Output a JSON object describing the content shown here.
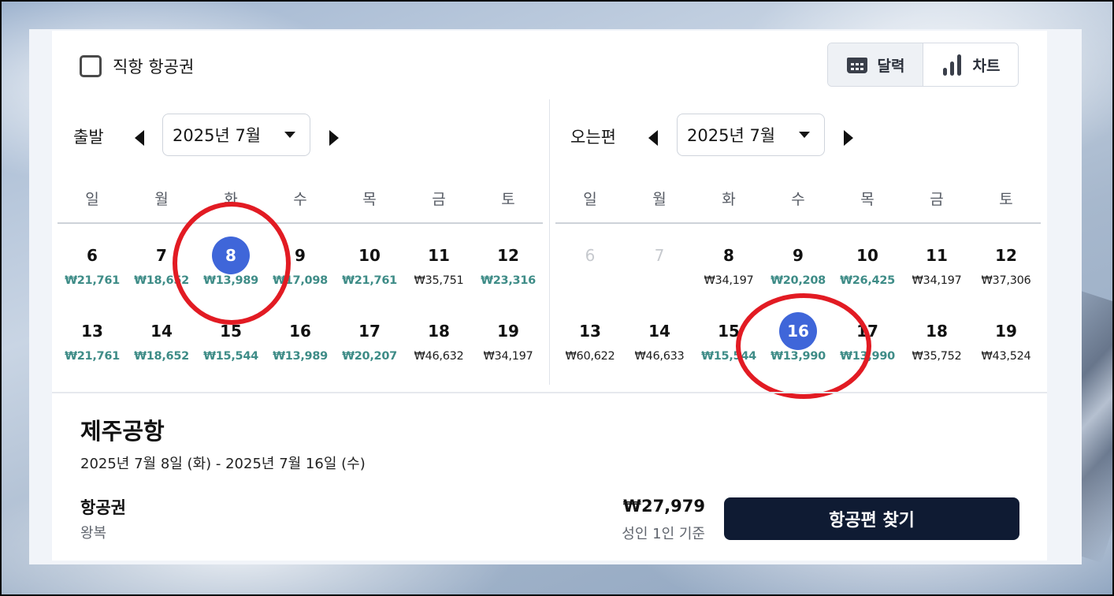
{
  "filter": {
    "direct_label": "직항 항공권",
    "direct_checked": false
  },
  "view_toggle": {
    "calendar_label": "달력",
    "chart_label": "차트",
    "active": "calendar"
  },
  "departure": {
    "label": "출발",
    "month": "2025년 7월",
    "weekdays": [
      "일",
      "월",
      "화",
      "수",
      "목",
      "금",
      "토"
    ],
    "weeks": [
      [
        {
          "day": "6",
          "price": "₩21,761",
          "cheap": true
        },
        {
          "day": "7",
          "price": "₩18,652",
          "cheap": true
        },
        {
          "day": "8",
          "price": "₩13,989",
          "cheap": true,
          "selected": true
        },
        {
          "day": "9",
          "price": "₩17,098",
          "cheap": true
        },
        {
          "day": "10",
          "price": "₩21,761",
          "cheap": true
        },
        {
          "day": "11",
          "price": "₩35,751",
          "cheap": false
        },
        {
          "day": "12",
          "price": "₩23,316",
          "cheap": true
        }
      ],
      [
        {
          "day": "13",
          "price": "₩21,761",
          "cheap": true
        },
        {
          "day": "14",
          "price": "₩18,652",
          "cheap": true
        },
        {
          "day": "15",
          "price": "₩15,544",
          "cheap": true
        },
        {
          "day": "16",
          "price": "₩13,989",
          "cheap": true
        },
        {
          "day": "17",
          "price": "₩20,207",
          "cheap": true
        },
        {
          "day": "18",
          "price": "₩46,632",
          "cheap": false
        },
        {
          "day": "19",
          "price": "₩34,197",
          "cheap": false
        }
      ]
    ]
  },
  "return": {
    "label": "오는편",
    "month": "2025년 7월",
    "weekdays": [
      "일",
      "월",
      "화",
      "수",
      "목",
      "금",
      "토"
    ],
    "weeks": [
      [
        {
          "day": "6",
          "price": "",
          "muted": true
        },
        {
          "day": "7",
          "price": "",
          "muted": true
        },
        {
          "day": "8",
          "price": "₩34,197",
          "cheap": false
        },
        {
          "day": "9",
          "price": "₩20,208",
          "cheap": true
        },
        {
          "day": "10",
          "price": "₩26,425",
          "cheap": true
        },
        {
          "day": "11",
          "price": "₩34,197",
          "cheap": false
        },
        {
          "day": "12",
          "price": "₩37,306",
          "cheap": false
        }
      ],
      [
        {
          "day": "13",
          "price": "₩60,622",
          "cheap": false
        },
        {
          "day": "14",
          "price": "₩46,633",
          "cheap": false
        },
        {
          "day": "15",
          "price": "₩15,544",
          "cheap": true
        },
        {
          "day": "16",
          "price": "₩13,990",
          "cheap": true,
          "selected": true
        },
        {
          "day": "17",
          "price": "₩13,990",
          "cheap": true
        },
        {
          "day": "18",
          "price": "₩35,752",
          "cheap": false
        },
        {
          "day": "19",
          "price": "₩43,524",
          "cheap": false
        }
      ]
    ]
  },
  "summary": {
    "destination": "제주공항",
    "date_range": "2025년 7월 8일 (화) - 2025년 7월 16일 (수)",
    "ticket_title": "항공권",
    "ticket_type": "왕복",
    "total_price": "₩27,979",
    "price_basis": "성인 1인 기준",
    "search_button": "항공편 찾기"
  },
  "colors": {
    "selected": "#3f66d9",
    "cheap_price": "#3e8c87",
    "annotation_ring": "#e21b23",
    "primary_button": "#0f1b33"
  }
}
